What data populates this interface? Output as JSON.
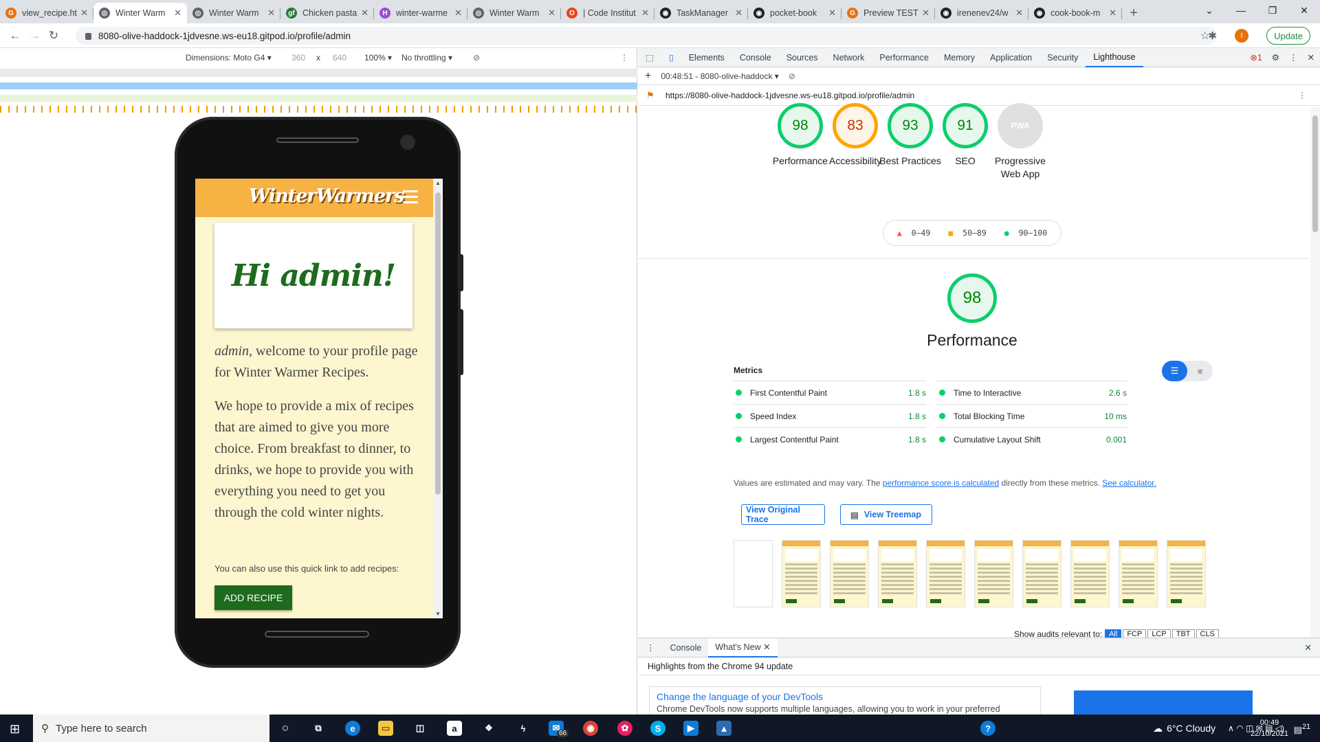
{
  "browser": {
    "tabs": [
      {
        "title": "view_recipe.ht",
        "color": "#e8710a",
        "glyph": "G"
      },
      {
        "title": "Winter Warm",
        "color": "#5f6368",
        "glyph": "◎",
        "active": true
      },
      {
        "title": "Winter Warm",
        "color": "#5f6368",
        "glyph": "◎"
      },
      {
        "title": "Chicken pasta",
        "color": "#2a7a3a",
        "glyph": "gf"
      },
      {
        "title": "winter-warme",
        "color": "#9c4bd6",
        "glyph": "H"
      },
      {
        "title": "Winter Warm",
        "color": "#5f6368",
        "glyph": "◎"
      },
      {
        "title": "| Code Institut",
        "color": "#e8471a",
        "glyph": "O"
      },
      {
        "title": "TaskManager",
        "color": "#202124",
        "glyph": "◉"
      },
      {
        "title": "pocket-book",
        "color": "#202124",
        "glyph": "◉"
      },
      {
        "title": "Preview TEST",
        "color": "#e8710a",
        "glyph": "G"
      },
      {
        "title": "irenenev24/w",
        "color": "#202124",
        "glyph": "◉"
      },
      {
        "title": "cook-book-m",
        "color": "#202124",
        "glyph": "◉"
      }
    ],
    "url": "8080-olive-haddock-1jdvesne.ws-eu18.gitpod.io/profile/admin",
    "update_label": "Update",
    "avatar_letter": "I"
  },
  "device_toolbar": {
    "dimensions_label": "Dimensions: Moto G4 ▾",
    "width": "360",
    "times": "x",
    "height": "640",
    "zoom": "100% ▾",
    "throttle": "No throttling ▾"
  },
  "site": {
    "brand": "WinterWarmers",
    "greeting": "Hi admin!",
    "welcome_user": "admin",
    "welcome_rest": ", welcome to your profile page for Winter Warmer Recipes.",
    "paragraph": "We hope to provide a mix of recipes that are aimed to give you more choice. From breakfast to dinner, to drinks, we hope to provide you with everything you need to get you through the cold winter nights.",
    "quick_link": "You can also use this quick link to add recipes:",
    "add_button": "ADD RECIPE"
  },
  "devtools": {
    "tabs": [
      "Elements",
      "Console",
      "Sources",
      "Network",
      "Performance",
      "Memory",
      "Application",
      "Security",
      "Lighthouse"
    ],
    "active_tab": "Lighthouse",
    "error_badge": "1",
    "report_label": "00:48:51 - 8080-olive-haddock ▾",
    "report_url": "https://8080-olive-haddock-1jdvesne.ws-eu18.gitpod.io/profile/admin",
    "scores": [
      {
        "label": "Performance",
        "value": 98,
        "color": "#0cce6b",
        "text": "#008800",
        "bg": "#e6f8ee"
      },
      {
        "label": "Accessibility",
        "value": 83,
        "color": "#ffa400",
        "text": "#c33300",
        "bg": "#fff5e6"
      },
      {
        "label": "Best Practices",
        "value": 93,
        "color": "#0cce6b",
        "text": "#008800",
        "bg": "#e6f8ee"
      },
      {
        "label": "SEO",
        "value": 91,
        "color": "#0cce6b",
        "text": "#008800",
        "bg": "#e6f8ee"
      },
      {
        "label": "Progressive Web App",
        "value": "PWA",
        "color": "#e0e0e0",
        "text": "#ffffff",
        "bg": "#e0e0e0"
      }
    ],
    "legend": [
      "0–49",
      "50–89",
      "90–100"
    ],
    "perf_score": "98",
    "perf_title": "Performance",
    "metrics_heading": "Metrics",
    "metrics_left": [
      {
        "name": "First Contentful Paint",
        "value": "1.8 s"
      },
      {
        "name": "Speed Index",
        "value": "1.8 s"
      },
      {
        "name": "Largest Contentful Paint",
        "value": "1.8 s"
      }
    ],
    "metrics_right": [
      {
        "name": "Time to Interactive",
        "value": "2.6 s"
      },
      {
        "name": "Total Blocking Time",
        "value": "10 ms"
      },
      {
        "name": "Cumulative Layout Shift",
        "value": "0.001"
      }
    ],
    "note_prefix": "Values are estimated and may vary. The ",
    "note_link": "performance score is calculated",
    "note_mid": " directly from these metrics. ",
    "note_link2": "See calculator.",
    "view_trace": "View Original Trace",
    "view_treemap": "View Treemap",
    "show_audits": "Show audits relevant to:",
    "audit_filters": [
      "All",
      "FCP",
      "LCP",
      "TBT",
      "CLS"
    ]
  },
  "drawer": {
    "tab_console": "Console",
    "tab_whats_new": "What's New",
    "highlights": "Highlights from the Chrome 94 update",
    "card_title": "Change the language of your DevTools",
    "card_text": "Chrome DevTools now supports multiple languages, allowing you to work in your preferred"
  },
  "taskbar": {
    "search_placeholder": "Type here to search",
    "weather": "6°C  Cloudy",
    "time": "00:49",
    "date": "22/10/2021",
    "notif_count": "21",
    "badge_66": "66"
  }
}
